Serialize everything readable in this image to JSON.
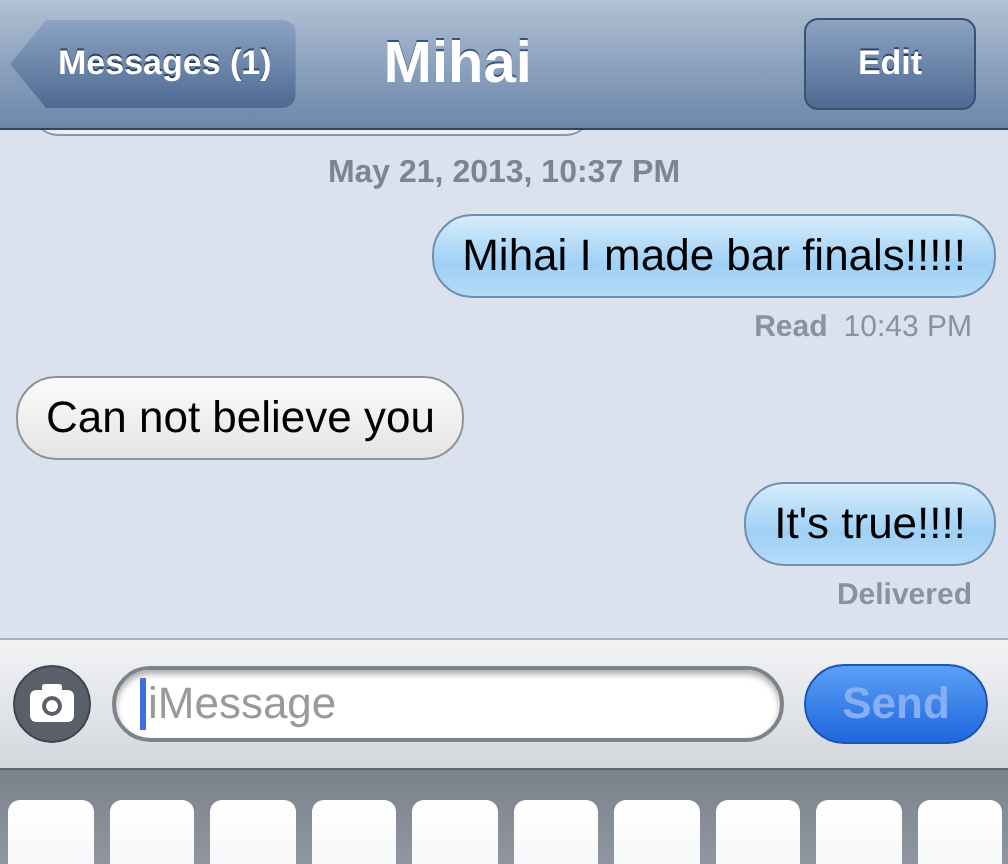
{
  "nav": {
    "back": "Messages (1)",
    "title": "Mihai",
    "edit": "Edit"
  },
  "thread": [
    {
      "kind": "timestamp",
      "text": "May 21, 2013, 10:37 PM"
    },
    {
      "kind": "sent",
      "text": "Mihai I made bar finals!!!!!"
    },
    {
      "kind": "receipt",
      "label": "Read",
      "time": "10:43 PM"
    },
    {
      "kind": "received",
      "text": "Can not believe you"
    },
    {
      "kind": "sent",
      "text": "It's true!!!!"
    },
    {
      "kind": "receipt",
      "label": "Delivered"
    }
  ],
  "composer": {
    "placeholder": "iMessage",
    "send": "Send",
    "send_disabled": true
  }
}
